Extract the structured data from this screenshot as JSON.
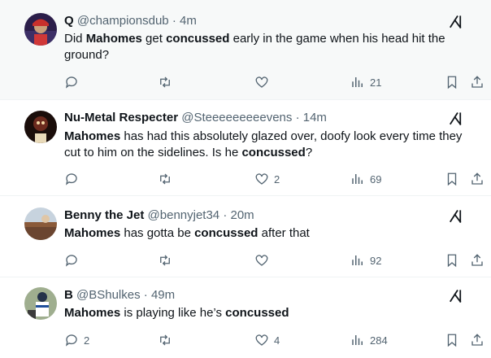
{
  "tweets": [
    {
      "name": "Q",
      "handle": "@championsdub",
      "time": "4m",
      "text_parts": [
        {
          "t": "Did ",
          "b": false
        },
        {
          "t": "Mahomes",
          "b": true
        },
        {
          "t": " get ",
          "b": false
        },
        {
          "t": "concussed",
          "b": true
        },
        {
          "t": " early in the game when his head hit the",
          "b": false
        },
        {
          "t": "ground?",
          "b": false
        }
      ],
      "replies": "",
      "retweets": "",
      "likes": "",
      "views": "21"
    },
    {
      "name": "Nu-Metal Respecter",
      "handle": "@Steeeeeeeeevens",
      "time": "14m",
      "text_parts": [
        {
          "t": "Mahomes",
          "b": true
        },
        {
          "t": " has had this absolutely glazed over, doofy look every time they",
          "b": false
        },
        {
          "t": "cut to him on the sidelines. Is he ",
          "b": false
        },
        {
          "t": "concussed",
          "b": true
        },
        {
          "t": "?",
          "b": false
        }
      ],
      "replies": "",
      "retweets": "",
      "likes": "2",
      "views": "69"
    },
    {
      "name": "Benny the Jet",
      "handle": "@bennyjet34",
      "time": "20m",
      "text_parts": [
        {
          "t": "Mahomes",
          "b": true
        },
        {
          "t": " has gotta be ",
          "b": false
        },
        {
          "t": "concussed",
          "b": true
        },
        {
          "t": " after that",
          "b": false
        }
      ],
      "replies": "",
      "retweets": "",
      "likes": "",
      "views": "92"
    },
    {
      "name": "B",
      "handle": "@BShulkes",
      "time": "49m",
      "text_parts": [
        {
          "t": "Mahomes",
          "b": true
        },
        {
          "t": " is playing like he’s ",
          "b": false
        },
        {
          "t": "concussed",
          "b": true
        }
      ],
      "replies": "2",
      "retweets": "",
      "likes": "4",
      "views": "284"
    }
  ],
  "separator": "·",
  "icons": {
    "reply": "reply-icon",
    "retweet": "retweet-icon",
    "like": "heart-icon",
    "views": "views-icon",
    "bookmark": "bookmark-icon",
    "share": "share-icon",
    "grok": "grok-icon"
  },
  "colors": {
    "text": "#0f1419",
    "muted": "#536471",
    "divider": "#eff3f4",
    "highlight_bg": "#f7f9f9"
  }
}
